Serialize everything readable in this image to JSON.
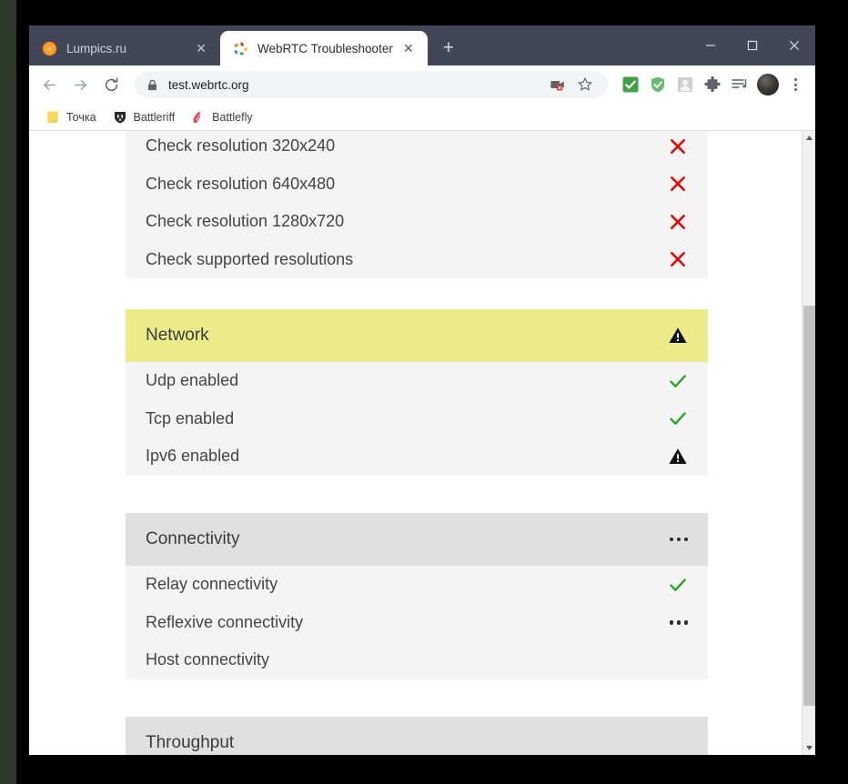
{
  "window": {
    "controls": [
      {
        "name": "minimize",
        "glyph": "—"
      },
      {
        "name": "maximize",
        "glyph": "▢"
      },
      {
        "name": "close",
        "glyph": "✕"
      }
    ]
  },
  "tabs": [
    {
      "title": "Lumpics.ru",
      "favicon": "orange-circle-icon",
      "active": false,
      "close_glyph": "✕"
    },
    {
      "title": "WebRTC Troubleshooter",
      "favicon": "webrtc-pinwheel-icon",
      "active": true,
      "close_glyph": "✕"
    }
  ],
  "new_tab_label": "+",
  "toolbar": {
    "back_label": "←",
    "forward_label": "→",
    "reload_label": "⟳",
    "url": "test.webrtc.org",
    "lock_icon": "lock-icon",
    "omnibox_icons": [
      "camera-blocked-icon",
      "bookmark-star-icon"
    ],
    "extension_icons": [
      "green-check-extension-icon",
      "adguard-shield-icon",
      "grey-person-extension-icon",
      "puzzle-extensions-icon",
      "playlist-music-icon"
    ],
    "avatar": "user-avatar",
    "menu_label": "⋮"
  },
  "bookmarks": [
    {
      "label": "Точка",
      "icon": "yellow-note-icon"
    },
    {
      "label": "Battleriff",
      "icon": "dark-shield-icon"
    },
    {
      "label": "Battlefly",
      "icon": "red-flame-icon"
    }
  ],
  "page": {
    "sections": [
      {
        "id": "camera-resolutions",
        "header": null,
        "rows": [
          {
            "label": "Check resolution 320x240",
            "status": "fail"
          },
          {
            "label": "Check resolution 640x480",
            "status": "fail"
          },
          {
            "label": "Check resolution 1280x720",
            "status": "fail"
          },
          {
            "label": "Check supported resolutions",
            "status": "fail"
          }
        ]
      },
      {
        "id": "network",
        "header": {
          "title": "Network",
          "status": "warning",
          "tone": "yellow"
        },
        "rows": [
          {
            "label": "Udp enabled",
            "status": "pass"
          },
          {
            "label": "Tcp enabled",
            "status": "pass"
          },
          {
            "label": "Ipv6 enabled",
            "status": "warning"
          }
        ]
      },
      {
        "id": "connectivity",
        "header": {
          "title": "Connectivity",
          "status": "running",
          "tone": "grey"
        },
        "rows": [
          {
            "label": "Relay connectivity",
            "status": "pass"
          },
          {
            "label": "Reflexive connectivity",
            "status": "running"
          },
          {
            "label": "Host connectivity",
            "status": "none"
          }
        ]
      },
      {
        "id": "throughput",
        "header": {
          "title": "Throughput",
          "status": "none",
          "tone": "grey"
        },
        "rows": []
      }
    ]
  },
  "scrollbar": {
    "up_arrow": "▲",
    "down_arrow": "▼"
  },
  "colors": {
    "tabstrip": "#424656",
    "warning_header": "#ebeb8c",
    "section_header": "#e0e0e0",
    "row_bg": "#f4f4f4",
    "fail": "#ee0000",
    "pass": "#11aa11",
    "text": "#444444"
  }
}
